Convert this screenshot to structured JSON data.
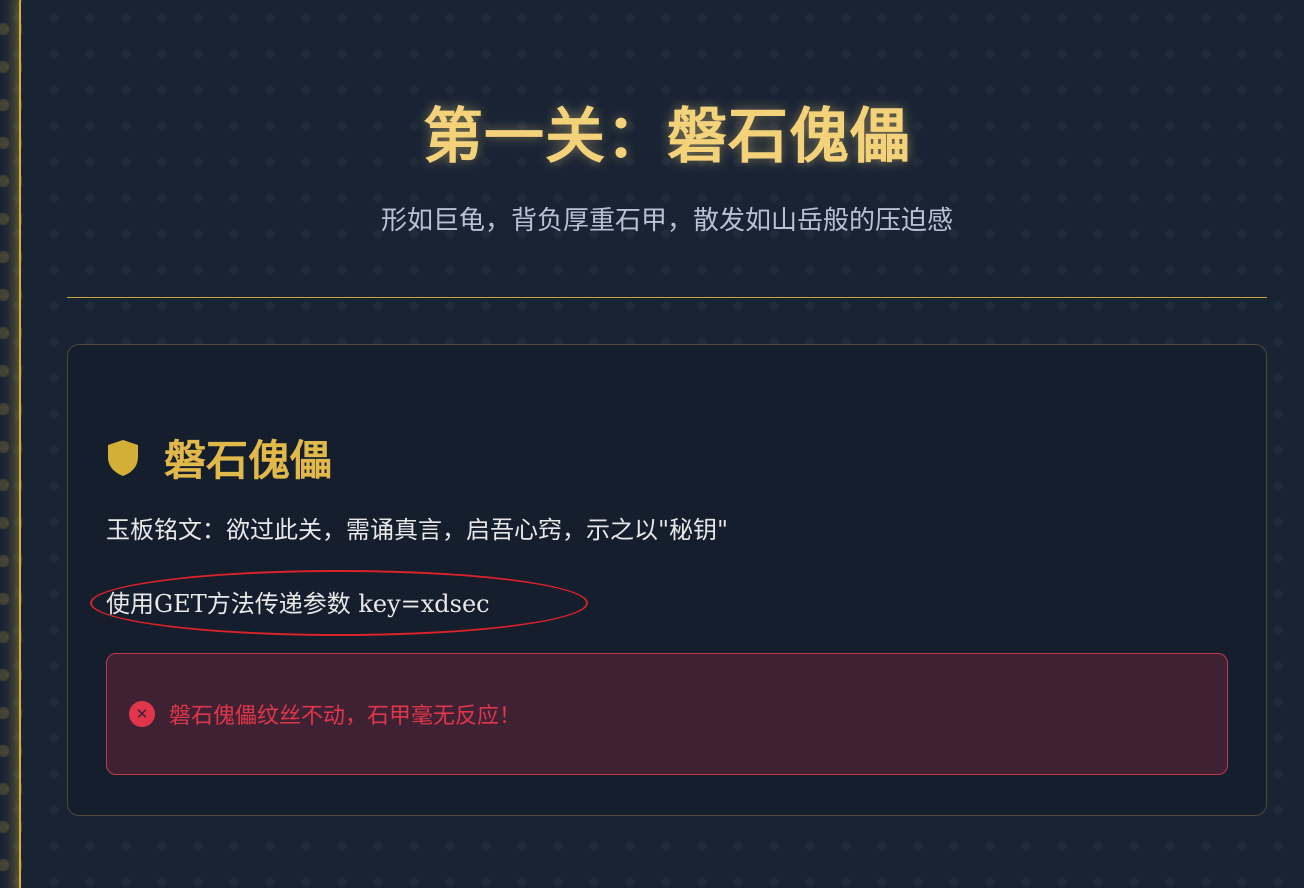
{
  "header": {
    "title": "第一关：磐石傀儡",
    "subtitle": "形如巨龟，背负厚重石甲，散发如山岳般的压迫感"
  },
  "card": {
    "icon": "shield-icon",
    "title": "磐石傀儡",
    "inscription": "玉板铭文：欲过此关，需诵真言，启吾心窍，示之以\"秘钥\"",
    "hint": "使用GET方法传递参数 key=xdsec"
  },
  "alert": {
    "icon": "error-circle-icon",
    "message": "磐石傀儡纹丝不动，石甲毫无反应！"
  },
  "colors": {
    "background": "#182334",
    "gold": "#d4af37",
    "title": "#f3d27a",
    "error": "#e0354a",
    "annotation_red": "#d9222a"
  }
}
